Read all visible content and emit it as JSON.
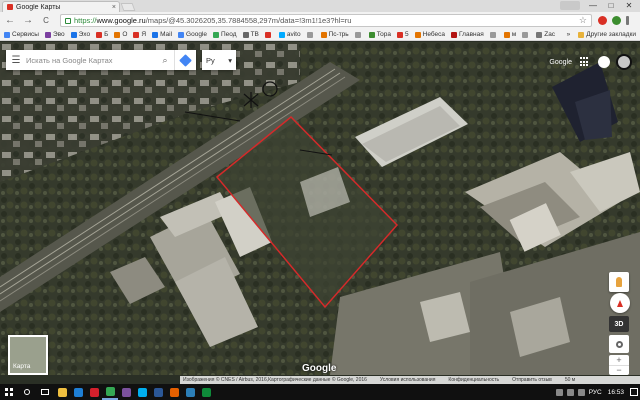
{
  "browser": {
    "tab_title": "Google Карты",
    "tab_close": "×",
    "window_controls": {
      "minimize": "—",
      "maximize": "□",
      "close": "✕"
    },
    "nav": {
      "back": "←",
      "forward": "→",
      "reload": "C"
    },
    "url_scheme": "https://",
    "url_host": "www.google.ru",
    "url_path": "/maps/@45.3026205,35.7884558,297m/data=!3m1!1e3?hl=ru",
    "star": "☆"
  },
  "bookmarks": {
    "items": [
      {
        "label": "Сервисы",
        "color": "#4285f4"
      },
      {
        "label": "Эво",
        "color": "#7b3fa0"
      },
      {
        "label": "Эхо",
        "color": "#1a73e8"
      },
      {
        "label": "Б",
        "color": "#d93025"
      },
      {
        "label": "О",
        "color": "#e37400"
      },
      {
        "label": "Я",
        "color": "#d93025"
      },
      {
        "label": "Mail",
        "color": "#1a73e8"
      },
      {
        "label": "Google",
        "color": "#4285f4"
      },
      {
        "label": "Пеод",
        "color": "#34a853"
      },
      {
        "label": "ТВ",
        "color": "#666666"
      },
      {
        "label": "",
        "color": "#d93025"
      },
      {
        "label": "avito",
        "color": "#00aaff"
      },
      {
        "label": "",
        "color": "#999999"
      },
      {
        "label": "Пс-трь",
        "color": "#e37400"
      },
      {
        "label": "",
        "color": "#999999"
      },
      {
        "label": "Тора",
        "color": "#3c8d2f"
      },
      {
        "label": "5",
        "color": "#d93025"
      },
      {
        "label": "Небеса",
        "color": "#e37400"
      },
      {
        "label": "Главная",
        "color": "#b31412"
      },
      {
        "label": "",
        "color": "#999999"
      },
      {
        "label": "м",
        "color": "#e37400"
      },
      {
        "label": "",
        "color": "#999999"
      },
      {
        "label": "Zac",
        "color": "#777777"
      }
    ],
    "more": "»",
    "other": "Другие закладки"
  },
  "map": {
    "menu_icon": "☰",
    "search_placeholder": "Искать на Google Картах",
    "search_glyph": "⌕",
    "lang": "Ру",
    "lang_caret": "▾",
    "signin": "Google",
    "layers_label": "Карта",
    "view_3d": "3D",
    "zoom_in": "+",
    "zoom_out": "−",
    "logo": "Google"
  },
  "attribution": {
    "imagery": "Изображения © CNES / Airbus, 2016,Картографические данные © Google, 2016",
    "terms": "Условия использования",
    "privacy": "Конфиденциальность",
    "feedback": "Отправить отзыв",
    "scale": "50 м"
  },
  "taskbar": {
    "apps": [
      {
        "name": "explorer",
        "color": "#f0c040"
      },
      {
        "name": "edge",
        "color": "#1e7fd6"
      },
      {
        "name": "opera",
        "color": "#d4202c"
      },
      {
        "name": "chrome",
        "color": "#34a853"
      },
      {
        "name": "viber",
        "color": "#7b519d"
      },
      {
        "name": "skype",
        "color": "#00aff0"
      },
      {
        "name": "word",
        "color": "#2b5797"
      },
      {
        "name": "firefox",
        "color": "#e66000"
      },
      {
        "name": "media",
        "color": "#2c7fb8"
      },
      {
        "name": "store",
        "color": "#0f8b3a"
      }
    ],
    "lang": "РУС",
    "time": "16:53"
  }
}
